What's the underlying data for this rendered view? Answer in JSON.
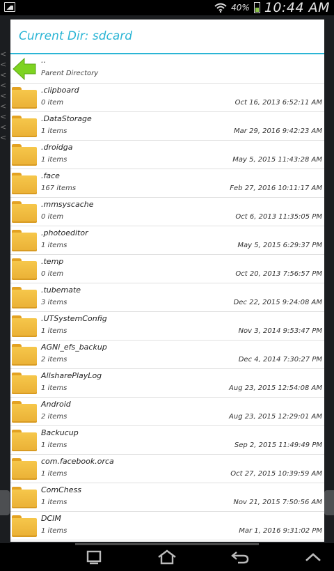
{
  "status": {
    "battery_pct": "40%",
    "time": "10:44 AM"
  },
  "dialog": {
    "title": "Current Dir: sdcard"
  },
  "parent": {
    "name": "..",
    "label": "Parent Directory"
  },
  "items": [
    {
      "name": ".clipboard",
      "count": "0 item",
      "date": "Oct 16, 2013 6:52:11 AM"
    },
    {
      "name": ".DataStorage",
      "count": "1 items",
      "date": "Mar 29, 2016 9:42:23 AM"
    },
    {
      "name": ".droidga",
      "count": "1 items",
      "date": "May 5, 2015 11:43:28 AM"
    },
    {
      "name": ".face",
      "count": "167 items",
      "date": "Feb 27, 2016 10:11:17 AM"
    },
    {
      "name": ".mmsyscache",
      "count": "0 item",
      "date": "Oct 6, 2013 11:35:05 PM"
    },
    {
      "name": ".photoeditor",
      "count": "1 items",
      "date": "May 5, 2015 6:29:37 PM"
    },
    {
      "name": ".temp",
      "count": "0 item",
      "date": "Oct 20, 2013 7:56:57 PM"
    },
    {
      "name": ".tubemate",
      "count": "3 items",
      "date": "Dec 22, 2015 9:24:08 AM"
    },
    {
      "name": ".UTSystemConfig",
      "count": "1 items",
      "date": "Nov 3, 2014 9:53:47 PM"
    },
    {
      "name": "AGNi_efs_backup",
      "count": "2 items",
      "date": "Dec 4, 2014 7:30:27 PM"
    },
    {
      "name": "AllsharePlayLog",
      "count": "1 items",
      "date": "Aug 23, 2015 12:54:08 AM"
    },
    {
      "name": "Android",
      "count": "2 items",
      "date": "Aug 23, 2015 12:29:01 AM"
    },
    {
      "name": "Backucup",
      "count": "1 items",
      "date": "Sep 2, 2015 11:49:49 PM"
    },
    {
      "name": "com.facebook.orca",
      "count": "1 items",
      "date": "Oct 27, 2015 10:39:59 AM"
    },
    {
      "name": "ComChess",
      "count": "1 items",
      "date": "Nov 21, 2015 7:50:56 AM"
    },
    {
      "name": "DCIM",
      "count": "1 items",
      "date": "Mar 1, 2016 9:31:02 PM"
    }
  ],
  "colors": {
    "accent": "#2bb5d5",
    "folder": "#f2bd42",
    "arrow": "#7ed321"
  }
}
